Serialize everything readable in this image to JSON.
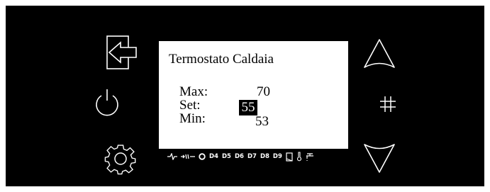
{
  "display": {
    "title": "Termostato Caldaia",
    "rows": [
      {
        "label": "Max:",
        "value": "70"
      },
      {
        "label": "Set:",
        "value": "55",
        "highlighted": true
      },
      {
        "label": "Min:",
        "value": "53"
      }
    ]
  },
  "status_bar": {
    "icons": [
      "pump-icon",
      "heat-pump-icon",
      "circle-icon",
      "box-icon",
      "thermometer-icon",
      "tap-icon"
    ],
    "labels": [
      "D4",
      "D5",
      "D6",
      "D7",
      "D8",
      "D9"
    ]
  },
  "buttons": {
    "left": [
      "exit-icon",
      "power-icon",
      "gear-icon"
    ],
    "right": [
      "up-arrow-icon",
      "hash-icon",
      "down-arrow-icon"
    ]
  },
  "colors": {
    "panel": "#000000",
    "screen": "#ffffff",
    "icons": "#ffffff"
  }
}
